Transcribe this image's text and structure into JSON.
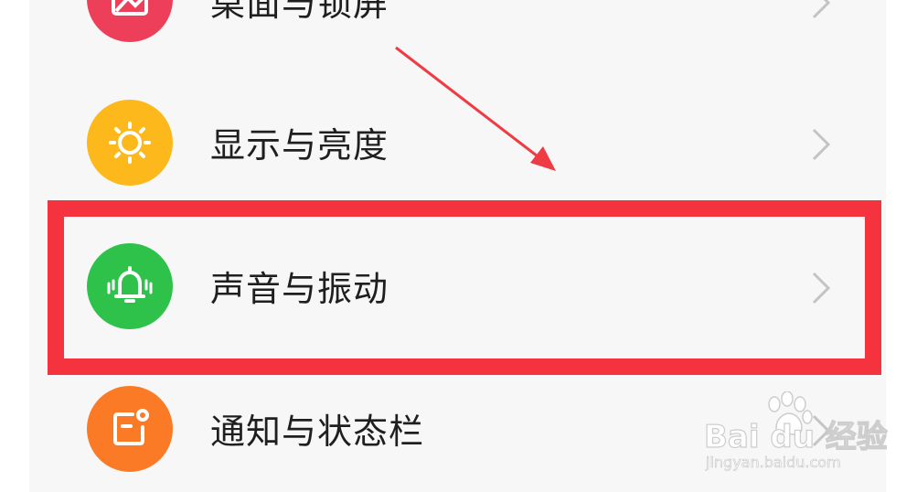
{
  "settings": {
    "items": [
      {
        "label": "桌面与锁屏",
        "icon": "image-icon",
        "color": "#ee3f5a"
      },
      {
        "label": "显示与亮度",
        "icon": "sun-icon",
        "color": "#fdb91b"
      },
      {
        "label": "声音与振动",
        "icon": "bell-vibrate-icon",
        "color": "#2ec24b"
      },
      {
        "label": "通知与状态栏",
        "icon": "notification-icon",
        "color": "#fb7a25"
      }
    ]
  },
  "annotation": {
    "highlight_color": "#f5333f",
    "arrow_color": "#ef3b44",
    "highlighted_item": "声音与振动"
  },
  "watermark": {
    "brand": "Bai du 经验",
    "url": "jingyan.baidu.com"
  }
}
